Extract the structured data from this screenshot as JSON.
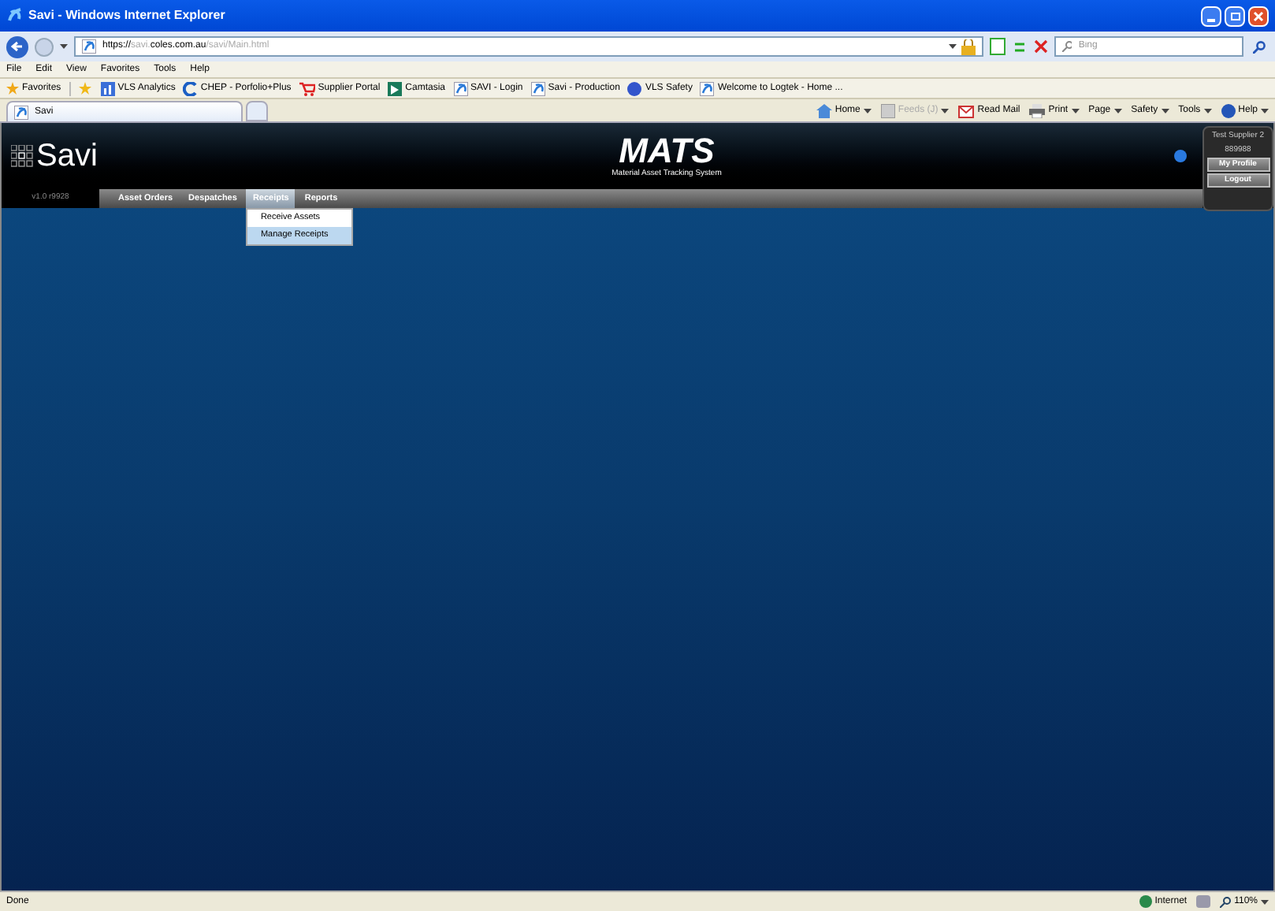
{
  "window": {
    "title": "Savi - Windows Internet Explorer"
  },
  "address": {
    "scheme": "https://",
    "host_prefix": "savi.",
    "host": "coles.com.au",
    "path": "/savi/Main.html"
  },
  "search": {
    "placeholder": "Bing"
  },
  "menu": [
    "File",
    "Edit",
    "View",
    "Favorites",
    "Tools",
    "Help"
  ],
  "favorites": {
    "label": "Favorites",
    "links": [
      {
        "label": "VLS Analytics",
        "kind": "chart"
      },
      {
        "label": "CHEP - Porfolio+Plus",
        "kind": "chep"
      },
      {
        "label": "Supplier Portal",
        "kind": "cart"
      },
      {
        "label": "Camtasia",
        "kind": "camtasia"
      },
      {
        "label": "SAVI - Login",
        "kind": "ie"
      },
      {
        "label": "Savi - Production",
        "kind": "ie"
      },
      {
        "label": "VLS Safety",
        "kind": "globe"
      },
      {
        "label": "Welcome to Logtek - Home ...",
        "kind": "ie"
      }
    ]
  },
  "tab": {
    "label": "Savi"
  },
  "command_bar": [
    {
      "label": "Home",
      "kind": "home",
      "dropdown": true,
      "disabled": false
    },
    {
      "label": "Feeds (J)",
      "kind": "feed",
      "dropdown": true,
      "disabled": true
    },
    {
      "label": "Read Mail",
      "kind": "mail",
      "dropdown": false,
      "disabled": false
    },
    {
      "label": "Print",
      "kind": "print",
      "dropdown": true,
      "disabled": false
    },
    {
      "label": "Page",
      "kind": "plain",
      "dropdown": true,
      "disabled": false
    },
    {
      "label": "Safety",
      "kind": "plain",
      "dropdown": true,
      "disabled": false
    },
    {
      "label": "Tools",
      "kind": "plain",
      "dropdown": true,
      "disabled": false
    },
    {
      "label": "Help",
      "kind": "help",
      "dropdown": true,
      "disabled": false
    }
  ],
  "app": {
    "logo": "Savi",
    "title": "MATS",
    "subtitle": "Material Asset Tracking System",
    "version": "v1.0 r9928",
    "user": {
      "name": "Test Supplier 2",
      "id": "889988",
      "buttons": [
        "My Profile",
        "Logout"
      ]
    },
    "nav": [
      {
        "label": "Asset Orders",
        "selected": false
      },
      {
        "label": "Despatches",
        "selected": false
      },
      {
        "label": "Receipts",
        "selected": true
      },
      {
        "label": "Reports",
        "selected": false
      }
    ],
    "dropdown": [
      {
        "label": "Receive Assets",
        "selected": false
      },
      {
        "label": "Manage Receipts",
        "selected": true
      }
    ]
  },
  "status_bar": {
    "text": "Done",
    "zone": "Internet",
    "zoom": "110%"
  }
}
